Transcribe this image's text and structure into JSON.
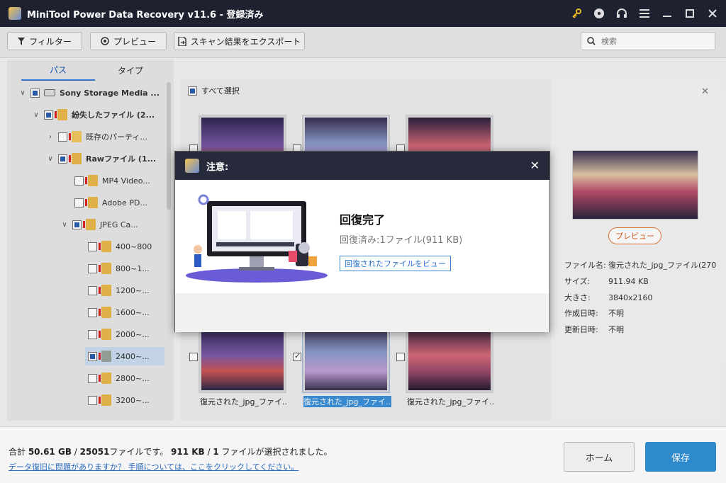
{
  "app": {
    "title": "MiniTool Power Data Recovery v11.6 - 登録済み"
  },
  "toolbar": {
    "filter_label": "フィルター",
    "preview_label": "プレビュー",
    "export_label": "スキャン結果をエクスポート",
    "search_placeholder": "検索"
  },
  "left": {
    "tabs": [
      "パス",
      "タイプ"
    ],
    "tree": [
      {
        "label": "Sony Storage Media ..."
      },
      {
        "label": "紛失したファイル (2..."
      },
      {
        "label": "既存のパーティ..."
      },
      {
        "label": "Rawファイル (1..."
      },
      {
        "label": "MP4 Video..."
      },
      {
        "label": "Adobe PD..."
      },
      {
        "label": "JPEG Ca..."
      },
      {
        "label": "400~800"
      },
      {
        "label": "800~1..."
      },
      {
        "label": "1200~..."
      },
      {
        "label": "1600~..."
      },
      {
        "label": "2000~..."
      },
      {
        "label": "2400~..."
      },
      {
        "label": "2800~..."
      },
      {
        "label": "3200~..."
      }
    ]
  },
  "middle": {
    "select_all": "すべて選択",
    "thumb_names": [
      "復元された_jpg_ファイ...",
      "復元された_jpg_ファイ...",
      "復元された_jpg_ファイ..."
    ]
  },
  "right": {
    "preview_button": "プレビュー",
    "info": [
      {
        "k": "ファイル名:",
        "v": "復元された_jpg_ファイル(270"
      },
      {
        "k": "サイズ:",
        "v": "911.94 KB"
      },
      {
        "k": "大きさ:",
        "v": "3840x2160"
      },
      {
        "k": "作成日時:",
        "v": "不明"
      },
      {
        "k": "更新日時:",
        "v": "不明"
      }
    ]
  },
  "bottom": {
    "summary_prefix": "合計 ",
    "total_size": "50.61 GB",
    "slash1": " / ",
    "total_files": "25051",
    "summary_mid": "ファイルです。 ",
    "selected_size": "911 KB",
    "slash2": " / ",
    "selected_count": "1",
    "summary_end": " ファイルが選択されました。",
    "help_link": "データ復旧に問題がありますか？ 手順については、ここをクリックしてください。",
    "home_label": "ホーム",
    "save_label": "保存"
  },
  "dialog": {
    "title": "注意:",
    "heading": "回復完了",
    "subtext": "回復済み:1ファイル(911 KB)",
    "view_button": "回復されたファイルをビュー"
  },
  "colors": {
    "titlebar": "#1e2230",
    "accent": "#3190d4",
    "preview_orange": "#e0773a",
    "selected_blue": "#3c8fd8"
  }
}
